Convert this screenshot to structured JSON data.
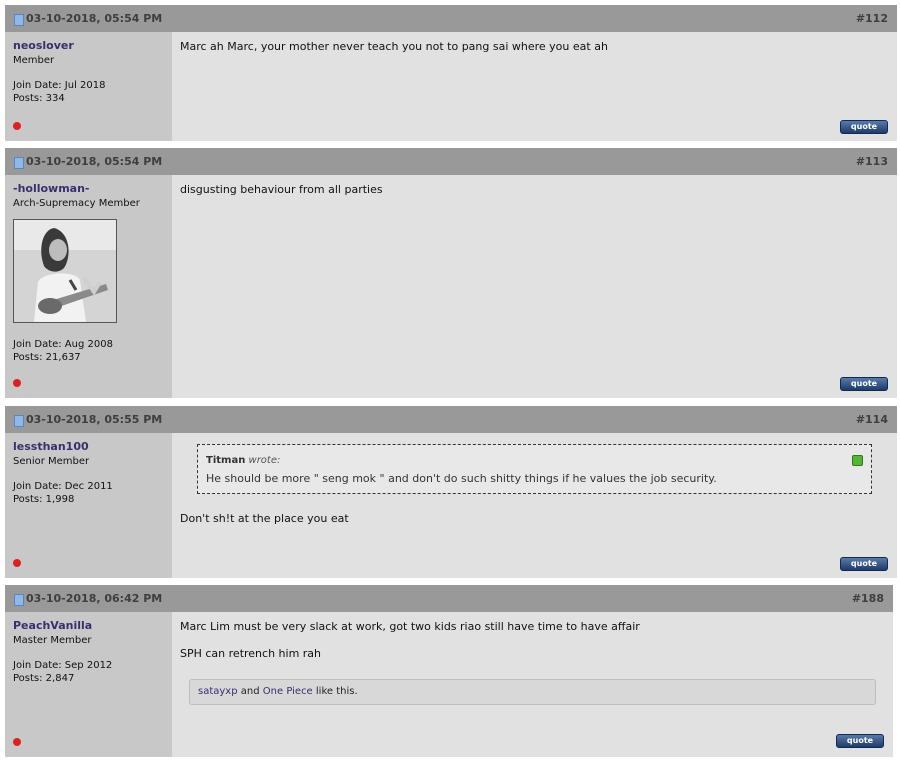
{
  "posts": [
    {
      "date": "03-10-2018, 05:54 PM",
      "number": "#112",
      "username": "neoslover",
      "rank": "Member",
      "join_date": "Join Date: Jul 2018",
      "posts": "Posts: 334",
      "message": [
        "Marc ah Marc, your mother never teach you not to pang sai where you eat ah"
      ],
      "quote_label": "quote",
      "online_status": "offline"
    },
    {
      "date": "03-10-2018, 05:54 PM",
      "number": "#113",
      "username": "-hollowman-",
      "rank": "Arch-Supremacy Member",
      "join_date": "Join Date: Aug 2008",
      "posts": "Posts: 21,637",
      "message": [
        "disgusting behaviour from all parties"
      ],
      "quote_label": "quote",
      "online_status": "offline",
      "has_avatar": true
    },
    {
      "date": "03-10-2018, 05:55 PM",
      "number": "#114",
      "username": "lessthan100",
      "rank": "Senior Member",
      "join_date": "Join Date: Dec 2011",
      "posts": "Posts: 1,998",
      "quote": {
        "author": "Titman",
        "wrote_label": "wrote:",
        "text": "He should be more \" seng mok \" and don't do such shitty things if he values the job security."
      },
      "message": [
        "Don't sh!t at the place you eat"
      ],
      "quote_label": "quote",
      "online_status": "offline"
    },
    {
      "date": "03-10-2018, 06:42 PM",
      "number": "#188",
      "username": "PeachVanilla",
      "rank": "Master Member",
      "join_date": "Join Date: Sep 2012",
      "posts": "Posts: 2,847",
      "message": [
        "Marc Lim must be very slack at work, got two kids riao still have time to have affair",
        "SPH can retrench him rah"
      ],
      "likes": {
        "user1": "satayxp",
        "conj": "and",
        "user2": "One Piece",
        "suffix": "like this."
      },
      "quote_label": "quote",
      "online_status": "offline"
    }
  ],
  "colors": {
    "header_bg": "#999999",
    "user_col_bg": "#c8c8c8",
    "msg_bg": "#e1e1e1",
    "username": "#3b2e6e",
    "status_offline": "#e02020",
    "quote_button": "#1d3b6b"
  }
}
